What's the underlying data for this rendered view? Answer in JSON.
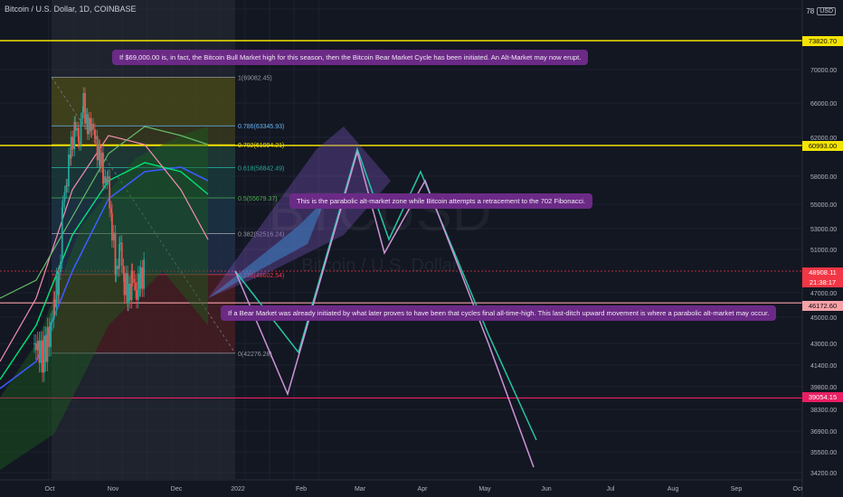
{
  "header": {
    "title": "Bitcoin / U.S. Dollar, 1D, COINBASE",
    "currency_label": "USD",
    "currency_value": "78"
  },
  "watermark": {
    "symbol": "BTCUSD",
    "name": "Bitcoin / U.S. Dollar"
  },
  "annotations": [
    "If $69,000.00 is, in fact, the Bitcoin Bull Market high for this season, then the Bitcoin Bear Market Cycle has been initiated. An Alt-Market may now erupt.",
    "This is the parabolic alt-market zone while Bitcoin attempts a retracement to the 702 Fibonacci.",
    "If a Bear Market was already initiated by what later proves to have been that cycles final all-time-high. This last-ditch upward movement is where a parabolic alt-market may occur."
  ],
  "price_tags": {
    "top": "73820.70",
    "mid": "60993.00",
    "current": "48908.11",
    "countdown": "21:38:17",
    "pink": "46172.60",
    "bottom": "39054.15"
  },
  "colors": {
    "yellow_line": "#f5e400",
    "red_line": "#e91e63",
    "pink_line": "#f7a1a8",
    "current_tag": "#f23645",
    "annotation_bg": "#6b2a86"
  },
  "chart_data": {
    "type": "candlestick",
    "symbol": "BTCUSD",
    "exchange": "COINBASE",
    "interval": "1D",
    "ylim": [
      34000,
      78000
    ],
    "y_ticks": [
      78000,
      70000,
      66000,
      62000,
      58000,
      55000,
      53000,
      51000,
      47000,
      45000,
      43000,
      41400,
      39800,
      38300,
      36900,
      35500,
      34200
    ],
    "x_ticks": [
      "Oct",
      "Nov",
      "Dec",
      "2022",
      "Feb",
      "Mar",
      "Apr",
      "May",
      "Jun",
      "Jul",
      "Aug",
      "Sep",
      "Oct"
    ],
    "horizontal_levels": [
      {
        "price": 73820.7,
        "color": "yellow"
      },
      {
        "price": 60993.0,
        "color": "yellow"
      },
      {
        "price": 46172.6,
        "color": "pink"
      },
      {
        "price": 39054.15,
        "color": "red"
      }
    ],
    "fibonacci": [
      {
        "ratio": "1",
        "price": 69082.45
      },
      {
        "ratio": "0.786",
        "price": 63345.93
      },
      {
        "ratio": "0.702",
        "price": 61094.21
      },
      {
        "ratio": "0.618",
        "price": 58842.49
      },
      {
        "ratio": "0.5",
        "price": 55679.37
      },
      {
        "ratio": "0.382",
        "price": 52516.24
      },
      {
        "ratio": "0.236",
        "price": 48602.54
      },
      {
        "ratio": "0",
        "price": 42276.28
      }
    ],
    "projection_paths": [
      {
        "color": "teal",
        "points": [
          [
            21,
            48908
          ],
          [
            55,
            41000
          ],
          [
            92,
            64000
          ],
          [
            118,
            54000
          ],
          [
            160,
            64000
          ],
          [
            210,
            40000
          ],
          [
            230,
            36000
          ]
        ]
      },
      {
        "color": "violet",
        "points": [
          [
            21,
            48908
          ],
          [
            48,
            39500
          ],
          [
            88,
            64000
          ],
          [
            105,
            52000
          ],
          [
            140,
            62000
          ],
          [
            180,
            41000
          ],
          [
            225,
            34300
          ]
        ]
      }
    ],
    "price_labels": [
      "78",
      "73820.70",
      "70000.00",
      "66000.00",
      "62000.00",
      "60993.00",
      "58000.00",
      "55000.00",
      "53000.00",
      "51000.00",
      "48908.11",
      "47000.00",
      "46172.60",
      "45000.00",
      "43000.00",
      "41400.00",
      "39800.00",
      "39054.15",
      "38300.00",
      "36900.00",
      "35500.00",
      "34200.00"
    ],
    "fib_labels": [
      "1(69082.45)",
      "0.786(63345.93)",
      "0.702(61094.21)",
      "0.618(58842.49)",
      "0.5(55679.37)",
      "0.382(52516.24)",
      "0.236(48602.54)",
      "0(42276.28)"
    ]
  }
}
